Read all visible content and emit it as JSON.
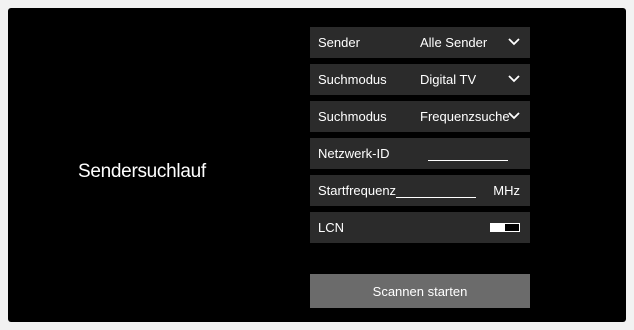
{
  "title": "Sendersuchlauf",
  "rows": [
    {
      "label": "Sender",
      "value": "Alle Sender"
    },
    {
      "label": "Suchmodus",
      "value": "Digital TV"
    },
    {
      "label": "Suchmodus",
      "value": "Frequenzsuche"
    },
    {
      "label": "Netzwerk-ID",
      "value": ""
    },
    {
      "label": "Startfrequenz",
      "value": "",
      "unit": "MHz"
    },
    {
      "label": "LCN",
      "toggle_on": false
    }
  ],
  "scan_button": "Scannen starten",
  "icons": {
    "dropdown": "chevron-down-icon",
    "toggle": "toggle-switch"
  }
}
